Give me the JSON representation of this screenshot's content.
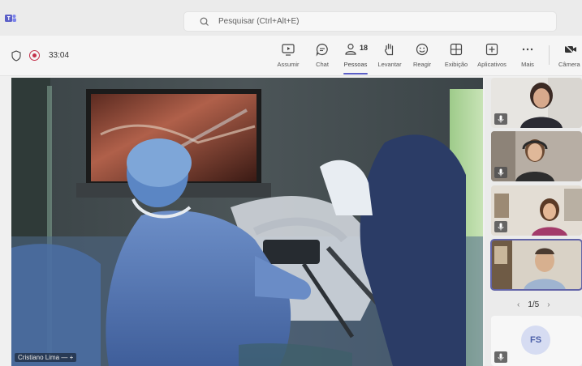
{
  "search": {
    "placeholder": "Pesquisar (Ctrl+Alt+E)"
  },
  "meeting": {
    "timer": "33:04",
    "participants_count": "18"
  },
  "toolbar": {
    "buttons": [
      {
        "label": "Assumir",
        "icon": "share-screen-icon"
      },
      {
        "label": "Chat",
        "icon": "chat-icon"
      },
      {
        "label": "Pessoas",
        "icon": "people-icon"
      },
      {
        "label": "Levantar",
        "icon": "raise-hand-icon"
      },
      {
        "label": "Reagir",
        "icon": "react-icon"
      },
      {
        "label": "Exibição",
        "icon": "view-icon"
      },
      {
        "label": "Aplicativos",
        "icon": "apps-icon"
      },
      {
        "label": "Mais",
        "icon": "more-icon"
      },
      {
        "label": "Câmera",
        "icon": "camera-off-icon"
      }
    ]
  },
  "stage": {
    "presenter_name": "Cristiano Lima"
  },
  "gallery": {
    "page": "1/5",
    "avatar_initials": "FS"
  },
  "colors": {
    "accent": "#5b5fc7",
    "recording": "#c4314b"
  }
}
